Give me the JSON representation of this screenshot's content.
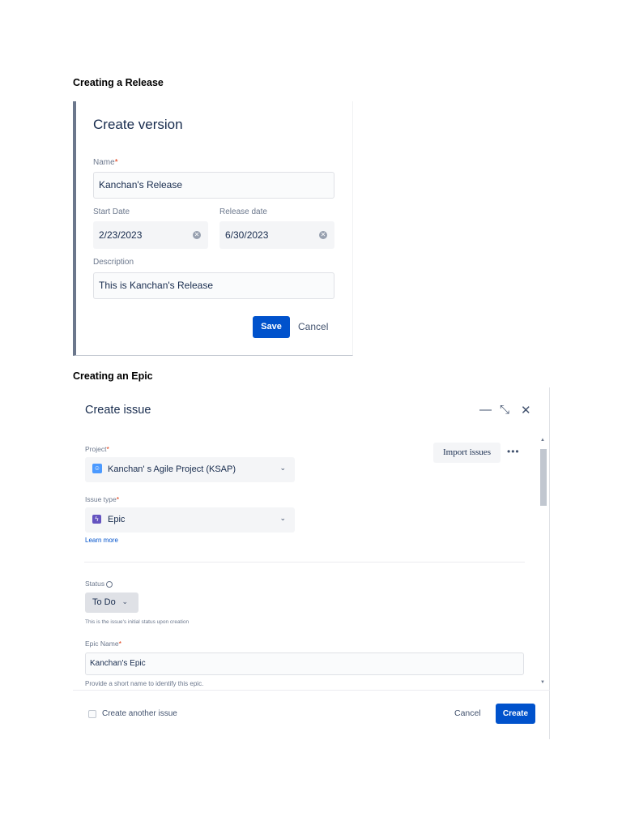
{
  "headings": {
    "release": "Creating a Release",
    "epic": "Creating an Epic"
  },
  "create_version": {
    "title": "Create version",
    "name_label": "Name",
    "required_marker": "*",
    "name_value": "Kanchan's Release",
    "start_date_label": "Start Date",
    "start_date_value": "2/23/2023",
    "release_date_label": "Release date",
    "release_date_value": "6/30/2023",
    "description_label": "Description",
    "description_value": "This is Kanchan's Release",
    "save_label": "Save",
    "cancel_label": "Cancel",
    "clear_icon": "clear-circle-icon"
  },
  "create_issue": {
    "title": "Create issue",
    "minimize_glyph": "—",
    "collapse_glyph": "⤡",
    "close_glyph": "✕",
    "project_label": "Project",
    "required_marker": "*",
    "project_value": "Kanchan' s Agile Project (KSAP)",
    "import_label": "Import issues",
    "more_glyph": "•••",
    "issue_type_label": "Issue type",
    "issue_type_value": "Epic",
    "learn_more": "Learn more",
    "status_label": "Status",
    "status_value": "To Do",
    "status_hint": "This is the issue's initial status upon creation",
    "epic_name_label": "Epic Name",
    "epic_name_value": "Kanchan's Epic",
    "epic_name_hint": "Provide a short name to identify this epic.",
    "create_another_label": "Create another issue",
    "cancel_label": "Cancel",
    "create_label": "Create"
  },
  "colors": {
    "primary": "#0052cc",
    "epic_purple": "#6554c0",
    "project_blue": "#4c9aff",
    "required_red": "#de350b"
  }
}
